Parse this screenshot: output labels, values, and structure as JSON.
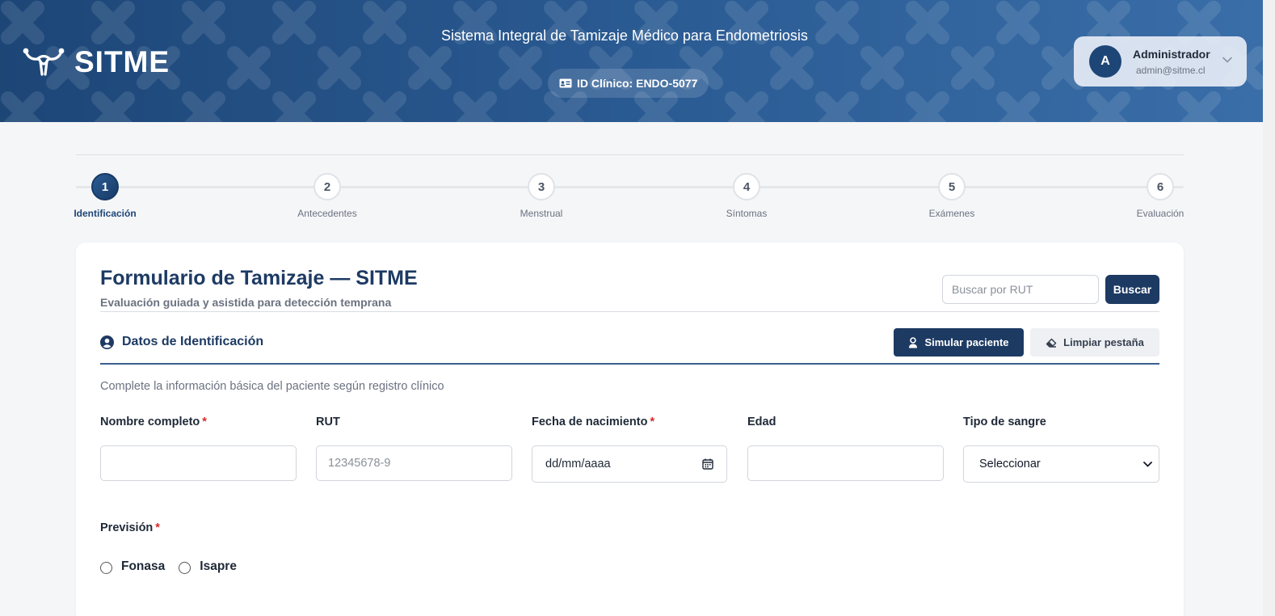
{
  "header": {
    "brand": "SITME",
    "title": "Sistema Integral de Tamizaje Médico para Endometriosis",
    "clinic_id": "ID Clínico: ENDO-5077",
    "user": {
      "initial": "A",
      "name": "Administrador",
      "email": "admin@sitme.cl"
    }
  },
  "stepper": {
    "steps": [
      {
        "number": "1",
        "label": "Identificación"
      },
      {
        "number": "2",
        "label": "Antecedentes"
      },
      {
        "number": "3",
        "label": "Menstrual"
      },
      {
        "number": "4",
        "label": "Síntomas"
      },
      {
        "number": "5",
        "label": "Exámenes"
      },
      {
        "number": "6",
        "label": "Evaluación"
      }
    ]
  },
  "form": {
    "title": "Formulario de Tamizaje — SITME",
    "subtitle": "Evaluación guiada y asistida para detección temprana",
    "search": {
      "placeholder": "Buscar por RUT",
      "button": "Buscar"
    }
  },
  "section": {
    "title": "Datos de Identificación",
    "simulate_button": "Simular paciente",
    "clear_button": "Limpiar pestaña",
    "description": "Complete la información básica del paciente según registro clínico"
  },
  "fields": {
    "name": {
      "label": "Nombre completo",
      "required": "*"
    },
    "rut": {
      "label": "RUT",
      "placeholder": "12345678-9"
    },
    "birthdate": {
      "label": "Fecha de nacimiento",
      "required": "*",
      "placeholder": "dd/mm/aaaa"
    },
    "age": {
      "label": "Edad"
    },
    "blood": {
      "label": "Tipo de sangre",
      "selected": "Seleccionar"
    }
  },
  "prevision": {
    "label": "Previsión",
    "required": "*",
    "options": [
      "Fonasa",
      "Isapre"
    ]
  },
  "colors": {
    "primary": "#1d3a63",
    "header_start": "#1d4677",
    "header_end": "#3a6ea8",
    "required": "#dc2626"
  }
}
